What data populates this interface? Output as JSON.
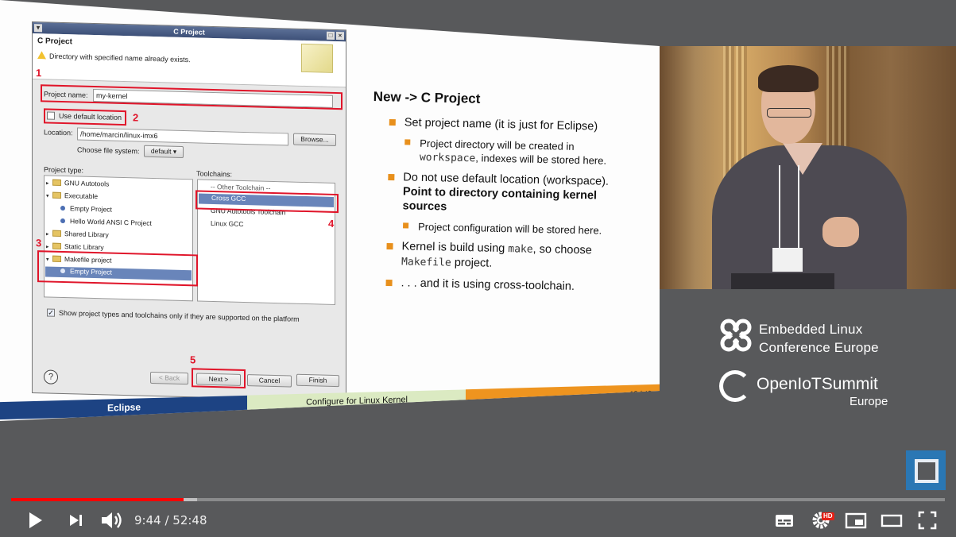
{
  "dialog": {
    "window_title": "C Project",
    "header_title": "C Project",
    "warning": "Directory with specified name already exists.",
    "project_name_label": "Project name:",
    "project_name_value": "my-kernel",
    "use_default_label": "Use default location",
    "location_label": "Location:",
    "location_value": "/home/marcin/linux-imx6",
    "browse": "Browse...",
    "filesystem_label": "Choose file system:",
    "filesystem_value": "default",
    "project_type_label": "Project type:",
    "toolchains_label": "Toolchains:",
    "project_types": [
      "GNU Autotools",
      "Executable",
      "Empty Project",
      "Hello World ANSI C Project",
      "Shared Library",
      "Static Library",
      "Makefile project",
      "Empty Project"
    ],
    "toolchains": [
      "-- Other Toolchain --",
      "Cross GCC",
      "GNU Autotools Toolchain",
      "Linux GCC"
    ],
    "show_supported_label": "Show project types and toolchains only if they are supported on the platform",
    "back": "< Back",
    "next": "Next >",
    "cancel": "Cancel",
    "finish": "Finish",
    "help": "?",
    "annotations": [
      "1",
      "2",
      "3",
      "4",
      "5"
    ]
  },
  "slide": {
    "heading": "New -> C Project",
    "b1": "Set project name (it is just for Eclipse)",
    "b1s_a": "Project directory will be created in",
    "b1s_mono": "workspace",
    "b1s_b": ", indexes will be stored here.",
    "b2_a": "Do not use default location (workspace).",
    "b2_bold": "Point to directory containing kernel sources",
    "b2s": "Project configuration will be stored here.",
    "b3_a": "Kernel is build using ",
    "b3_mono1": "make",
    "b3_b": ", so choose",
    "b3_mono2": "Makefile",
    "b3_c": " project.",
    "b4": ". . . and it is using cross-toolchain.",
    "footer_left": "Eclipse",
    "footer_mid": "Configure for Linux Kernel",
    "footer_page": "13 / 49"
  },
  "branding": {
    "elc_line1": "Embedded Linux",
    "elc_line2": "Conference Europe",
    "iot_line1": "OpenIoTSummit",
    "iot_line2": "Europe"
  },
  "player": {
    "time": "9:44 / 52:48",
    "played_fraction": 0.185,
    "buffered_fraction": 0.199,
    "hd_label": "HD",
    "accent": "#ff0000",
    "icons": [
      "play-icon",
      "next-icon",
      "volume-icon",
      "subtitles-icon",
      "settings-icon",
      "miniplayer-icon",
      "theater-icon",
      "fullscreen-icon"
    ]
  }
}
